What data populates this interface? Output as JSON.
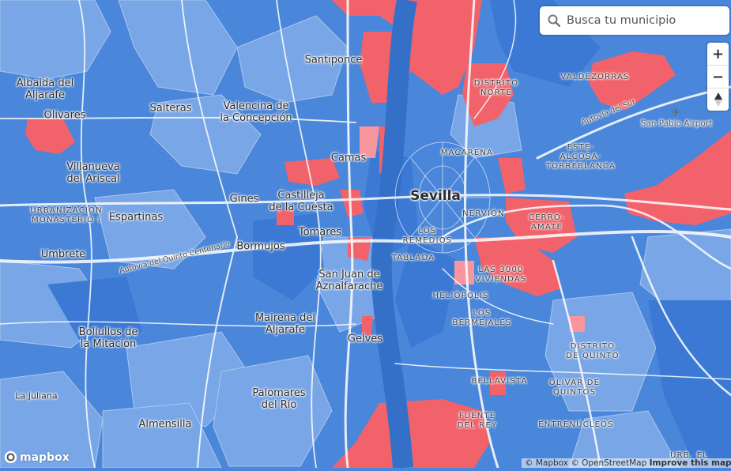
{
  "search": {
    "placeholder": "Busca tu municipio",
    "icon": "magnifier"
  },
  "controls": {
    "zoom_in": "+",
    "zoom_out": "−",
    "compass": "▲"
  },
  "logo": {
    "text": "mapbox"
  },
  "attribution": {
    "mapbox": "© Mapbox",
    "osm": "© OpenStreetMap",
    "improve": "Improve this map"
  },
  "colors": {
    "blue_dark": "#3a78d3",
    "blue_mid": "#5b90de",
    "blue_light": "#8fb4ea",
    "red": "#f2626b",
    "red_light": "#f79aa0",
    "road": "#ffffff"
  },
  "labels": {
    "albaida": "Albaida del\nAljarafe",
    "olivares": "Olivares",
    "salteras": "Salteras",
    "valencina": "Valencina de\nla Concepción",
    "santiponce": "Santiponce",
    "distrito_norte": "DISTRITO\nNORTE",
    "valdezorras": "VALDEZORRAS",
    "autovia_sur": "Autovía del Sur",
    "airport": "San Pablo Airport",
    "villanueva": "Villanueva\ndel Ariscal",
    "camas": "Camas",
    "macarena": "MACARENA",
    "este": "ESTE-\nALCOSA-\nTORREBLANCA",
    "gines": "Gines",
    "castilleja": "Castilleja\nde la Cuesta",
    "sevilla": "Sevilla",
    "urbanizacion": "URBANIZACIÓN\nMONASTERIO I",
    "espartinas": "Espartinas",
    "nervion": "NERVIÓN",
    "cerro": "CERRO-\nAMATE",
    "tomares": "Tomares",
    "los_remedios": "LOS\nREMEDIOS",
    "bormujos": "Bormujos",
    "autovia_quinto": "Autovía del Quinto Centenario",
    "umbrete": "Umbrete",
    "tablada": "TABLADA",
    "san_juan": "San Juan de\nAznalfarache",
    "las_3000": "LAS 3000\nVIVIENDAS",
    "heliopolis": "HELIÓPOLIS",
    "mairena": "Mairena del\nAljarafe",
    "los_bermejales": "LOS\nBERMEJALES",
    "bollullos": "Bollullos de\nla Mitación",
    "gelves": "Gelves",
    "distrito_quinto": "DISTRITO\nDE QUINTO",
    "olivar": "OLIVAR DE\nQUINTOS",
    "bellavista": "BELLAVISTA",
    "palomares": "Palomares\ndel Río",
    "la_juliana": "La Juliana",
    "fuente": "FUENTE\nDEL REY",
    "entrenucleos": "ENTRENÚCLEOS",
    "almensilla": "Almensilla",
    "urb_el": "URB. EL"
  }
}
